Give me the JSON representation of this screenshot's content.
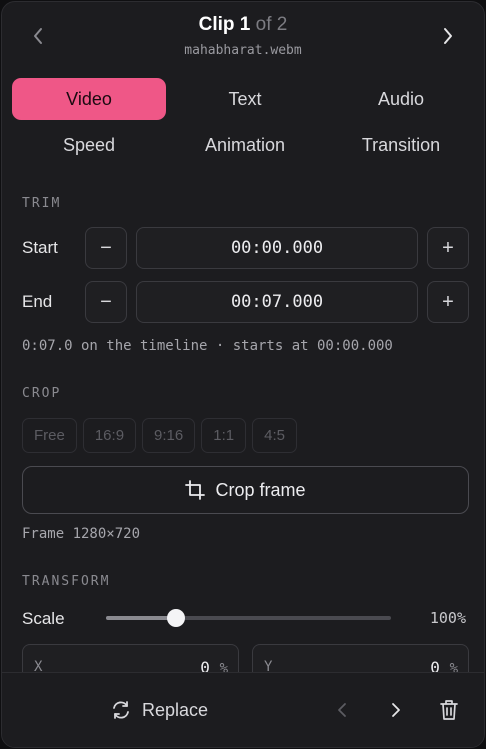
{
  "header": {
    "clip_label": "Clip 1",
    "of_label": "of 2",
    "filename": "mahabharat.webm",
    "prev_icon": "chevron-left-icon",
    "next_icon": "chevron-right-icon"
  },
  "tabs": [
    {
      "label": "Video",
      "active": true
    },
    {
      "label": "Text",
      "active": false
    },
    {
      "label": "Audio",
      "active": false
    },
    {
      "label": "Speed",
      "active": false
    },
    {
      "label": "Animation",
      "active": false
    },
    {
      "label": "Transition",
      "active": false
    }
  ],
  "trim": {
    "section_label": "TRIM",
    "start_label": "Start",
    "start_value": "00:00.000",
    "end_label": "End",
    "end_value": "00:07.000",
    "minus_symbol": "−",
    "plus_symbol": "+",
    "hint": "0:07.0 on the timeline · starts at 00:00.000"
  },
  "crop": {
    "section_label": "CROP",
    "ratios": [
      "Free",
      "16:9",
      "9:16",
      "1:1",
      "4:5"
    ],
    "crop_button_label": "Crop frame",
    "crop_icon": "crop-icon",
    "frame_info": "Frame 1280×720"
  },
  "transform": {
    "section_label": "TRANSFORM",
    "scale_label": "Scale",
    "scale_value": "100%",
    "scale_slider_fraction": 0.245,
    "x_label": "X",
    "x_value": "0",
    "y_label": "Y",
    "y_value": "0",
    "unit": "%"
  },
  "footer": {
    "replace_label": "Replace",
    "replace_icon": "refresh-icon",
    "prev_icon": "chevron-left-icon",
    "next_icon": "chevron-right-icon",
    "delete_icon": "trash-icon"
  },
  "colors": {
    "accent": "#ef5787",
    "panel_bg": "#1c1c1f",
    "border": "#3a3a3f"
  }
}
